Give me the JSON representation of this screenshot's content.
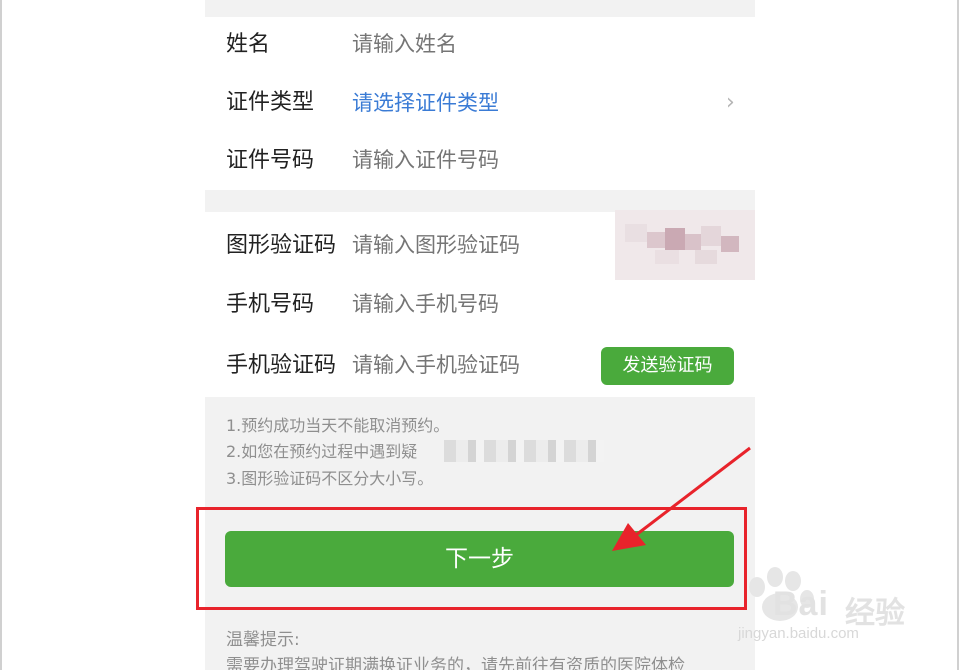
{
  "form": {
    "name": {
      "label": "姓名",
      "placeholder": "请输入姓名"
    },
    "id_type": {
      "label": "证件类型",
      "value": "请选择证件类型",
      "chevron": "›"
    },
    "id_number": {
      "label": "证件号码",
      "placeholder": "请输入证件号码"
    },
    "captcha": {
      "label": "图形验证码",
      "placeholder": "请输入图形验证码"
    },
    "phone": {
      "label": "手机号码",
      "placeholder": "请输入手机号码"
    },
    "sms_code": {
      "label": "手机验证码",
      "placeholder": "请输入手机验证码",
      "send_label": "发送验证码"
    }
  },
  "notes": [
    "1.预约成功当天不能取消预约。",
    "2.如您在预约过程中遇到疑",
    "3.图形验证码不区分大小写。"
  ],
  "next_label": "下一步",
  "warm_tip": {
    "title": "温馨提示:",
    "text": "需要办理驾驶证期满换证业务的，请先前往有资质的医院体检"
  },
  "watermark": {
    "brand": "Bai",
    "brand_cn": "经验",
    "url": "jingyan.baidu.com"
  },
  "colors": {
    "accent_green": "#4aaa3c",
    "link_blue": "#3a7bd5",
    "annotation_red": "#e8232b"
  }
}
